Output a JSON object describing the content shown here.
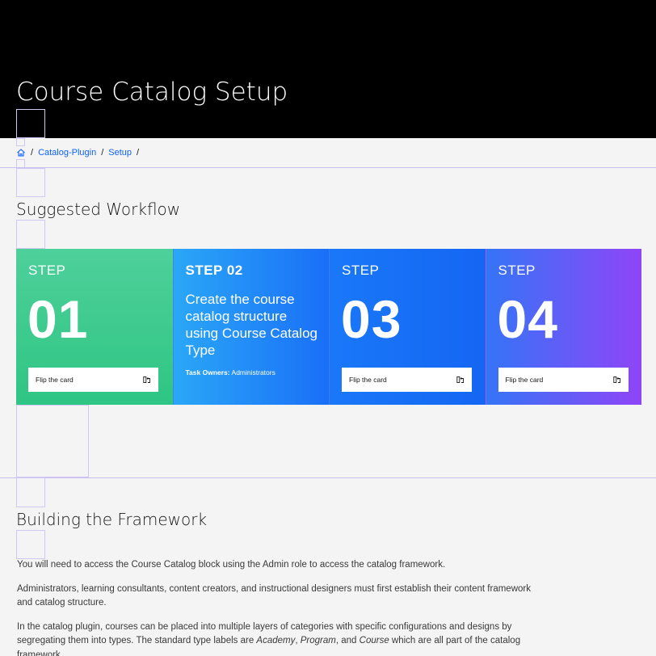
{
  "header": {
    "title": "Course Catalog Setup"
  },
  "breadcrumb": {
    "home_icon": "home-icon",
    "separator": "/",
    "items": [
      "Catalog-Plugin",
      "Setup"
    ]
  },
  "workflow": {
    "title": "Suggested Workflow",
    "flip_label": "Flip the card",
    "cards": [
      {
        "step_label": "STEP",
        "number": "01"
      },
      {
        "step_label": "STEP 02",
        "description": "Create the course catalog structure using Course Catalog Type",
        "task_owners_label": "Task Owners:",
        "task_owners_value": "Administrators"
      },
      {
        "step_label": "STEP",
        "number": "03"
      },
      {
        "step_label": "STEP",
        "number": "04"
      }
    ]
  },
  "framework": {
    "title": "Building the Framework",
    "p1": "You will need to access the Course Catalog block using the Admin role to access the catalog framework.",
    "p2": "Administrators, learning consultants, content creators, and instructional designers must first establish their content framework and catalog structure.",
    "p3_start": "In the catalog plugin, courses can be placed into multiple layers of categories with specific configurations and designs by segregating them into types. The standard type labels are ",
    "p3_term1": "Academy",
    "p3_comma": ", ",
    "p3_term2": "Program",
    "p3_and": ", and ",
    "p3_term3": "Course",
    "p3_end": " which are all part of the catalog framework."
  },
  "colors": {
    "header_bg": "#000000",
    "link": "#0f62fe",
    "card1": "#3fca8e",
    "card2": "#2196f7",
    "card3": "#1a70f6",
    "card4": "#8f45f7"
  }
}
